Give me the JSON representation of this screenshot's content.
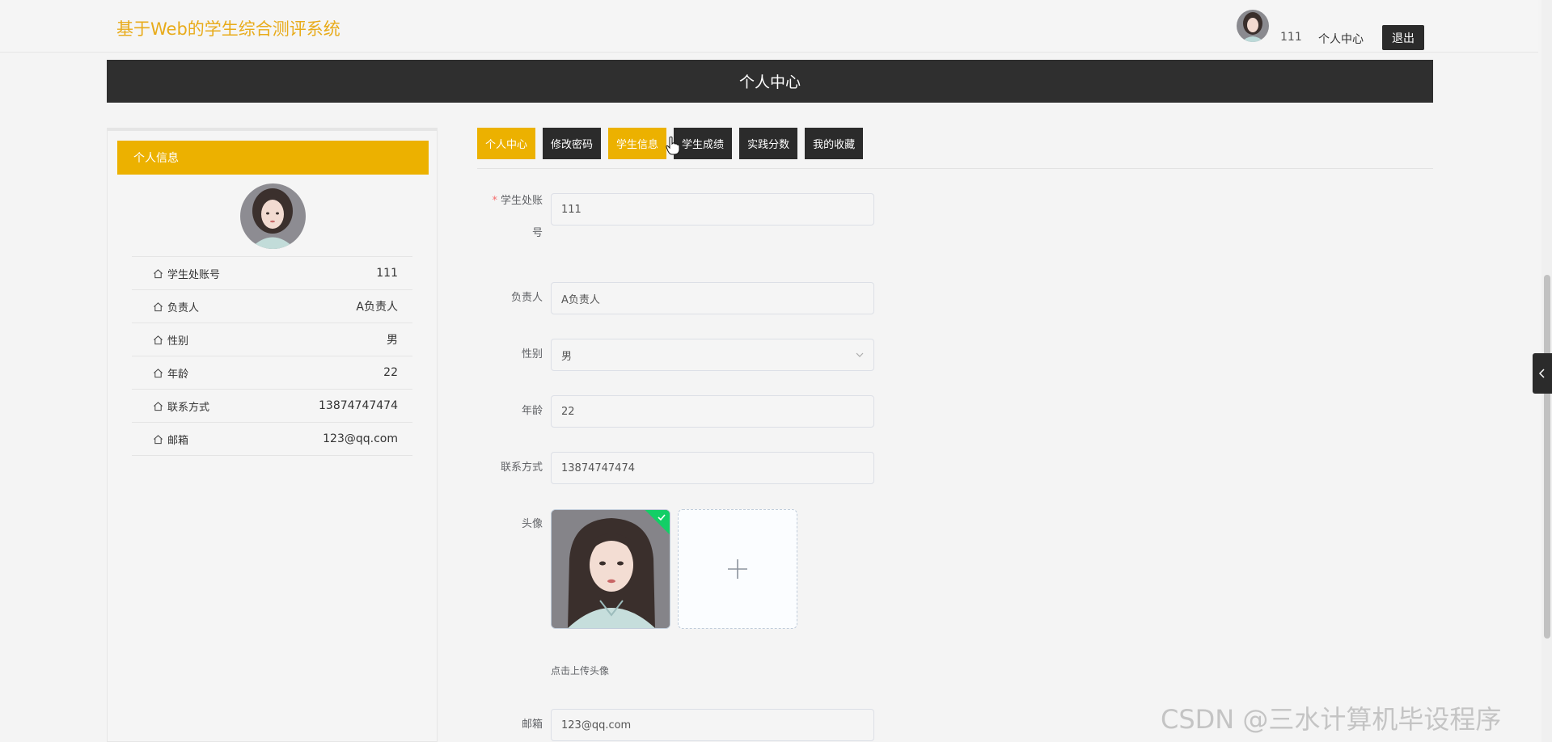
{
  "header": {
    "site_title": "基于Web的学生综合测评系统",
    "username": "111",
    "personal_center": "个人中心",
    "logout": "退出"
  },
  "banner": {
    "title": "个人中心"
  },
  "sidebar": {
    "heading": "个人信息",
    "rows": [
      {
        "label": "学生处账号",
        "value": "111"
      },
      {
        "label": "负责人",
        "value": "A负责人"
      },
      {
        "label": "性别",
        "value": "男"
      },
      {
        "label": "年龄",
        "value": "22"
      },
      {
        "label": "联系方式",
        "value": "13874747474"
      },
      {
        "label": "邮箱",
        "value": "123@qq.com"
      }
    ]
  },
  "tabs": [
    {
      "label": "个人中心",
      "active": true
    },
    {
      "label": "修改密码",
      "active": false
    },
    {
      "label": "学生信息",
      "active": true
    },
    {
      "label": "学生成绩",
      "active": false
    },
    {
      "label": "实践分数",
      "active": false
    },
    {
      "label": "我的收藏",
      "active": false
    }
  ],
  "form": {
    "account": {
      "label_line1": "学生处账",
      "label_line2": "号",
      "required_mark": "*",
      "value": "111"
    },
    "manager": {
      "label": "负责人",
      "value": "A负责人"
    },
    "gender": {
      "label": "性别",
      "value": "男"
    },
    "age": {
      "label": "年龄",
      "value": "22"
    },
    "phone": {
      "label": "联系方式",
      "value": "13874747474"
    },
    "avatar": {
      "label": "头像",
      "tip": "点击上传头像"
    },
    "email": {
      "label": "邮箱",
      "value": "123@qq.com"
    }
  },
  "watermark": "CSDN @三水计算机毕设程序",
  "colors": {
    "accent": "#ecb100",
    "title": "#e8ab1a",
    "dark": "#2b2b2b",
    "success": "#13ce66"
  }
}
